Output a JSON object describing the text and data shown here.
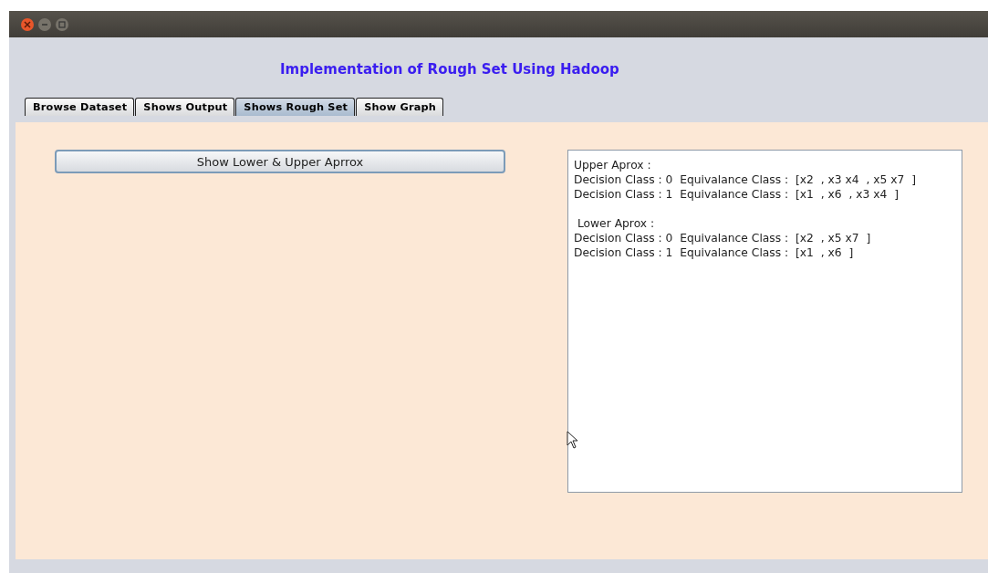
{
  "heading": "Implementation of Rough Set Using Hadoop",
  "tabs": [
    {
      "label": "Browse Dataset",
      "selected": false
    },
    {
      "label": "Shows Output",
      "selected": false
    },
    {
      "label": "Shows Rough Set",
      "selected": true
    },
    {
      "label": "Show Graph",
      "selected": false
    }
  ],
  "action_button": "Show Lower & Upper Aprrox",
  "output": {
    "sections": [
      {
        "heading": "Upper Aprox :",
        "lines": [
          "Decision Class : 0  Equivalance Class :  [x2  , x3 x4  , x5 x7  ]",
          "Decision Class : 1  Equivalance Class :  [x1  , x6  , x3 x4  ]"
        ]
      },
      {
        "heading": " Lower Aprox :",
        "lines": [
          "Decision Class : 0  Equivalance Class :  [x2  , x5 x7  ]",
          "Decision Class : 1  Equivalance Class :  [x1  , x6  ]"
        ]
      }
    ]
  }
}
